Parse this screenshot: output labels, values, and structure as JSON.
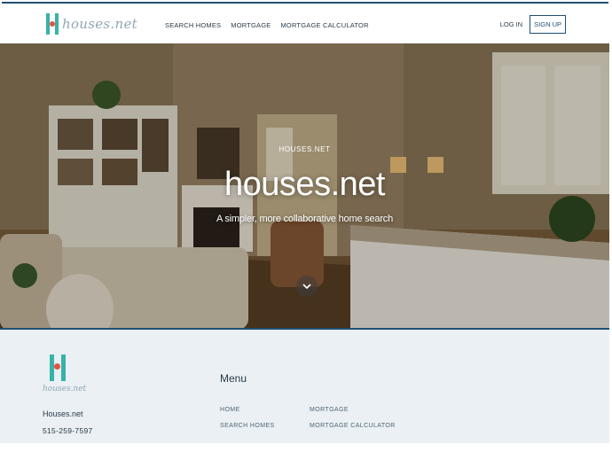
{
  "header": {
    "logo_text": "houses.net",
    "nav": [
      {
        "label": "SEARCH HOMES"
      },
      {
        "label": "MORTGAGE"
      },
      {
        "label": "MORTGAGE CALCULATOR"
      }
    ],
    "login_label": "LOG IN",
    "signup_label": "SIGN UP"
  },
  "hero": {
    "eyebrow": "HOUSES.NET",
    "title": "houses.net",
    "subtitle": "A simpler, more collaborative home search"
  },
  "footer": {
    "logo_text": "houses.net",
    "company_name": "Houses.net",
    "phone": "515-259-7597",
    "menu_heading": "Menu",
    "menu_links": [
      {
        "label": "HOME"
      },
      {
        "label": "MORTGAGE"
      },
      {
        "label": "SEARCH HOMES"
      },
      {
        "label": "MORTGAGE CALCULATOR"
      }
    ]
  },
  "colors": {
    "brand_teal": "#37b3a7",
    "brand_red": "#e4543f",
    "brand_navy": "#1f4f73",
    "footer_bg": "#eaf0f3"
  },
  "icons": [
    "logo-mark-icon",
    "chevron-down-icon"
  ]
}
